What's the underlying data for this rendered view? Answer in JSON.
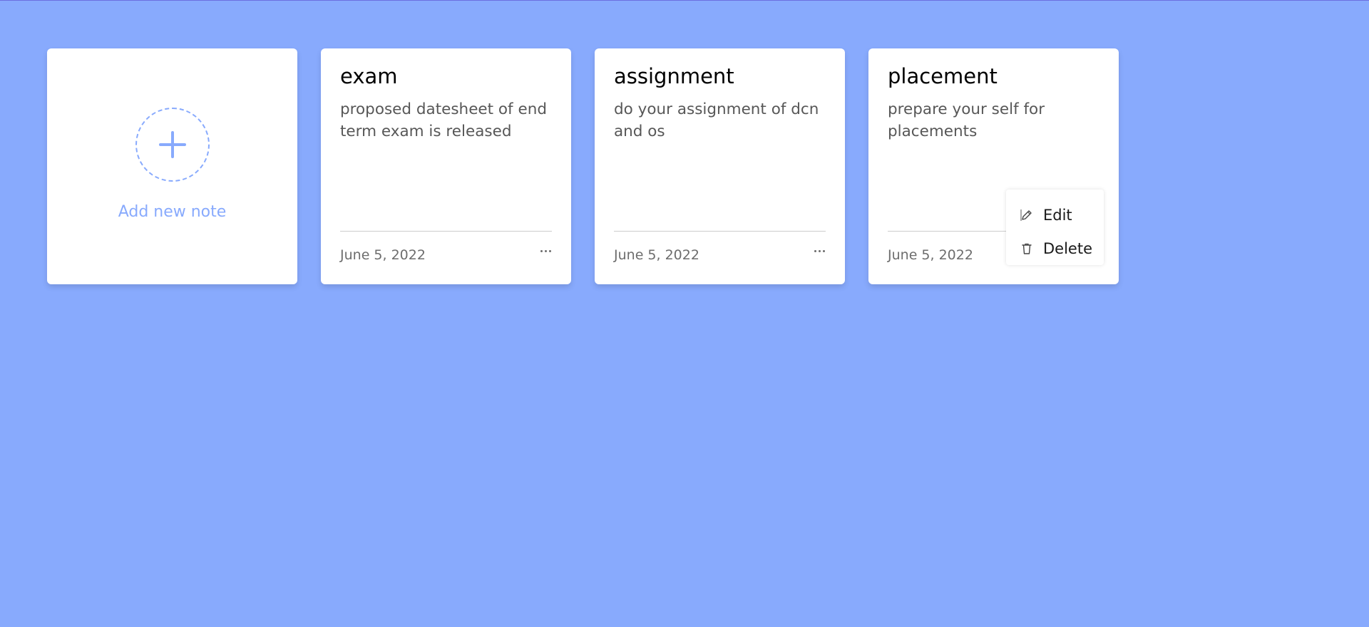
{
  "colors": {
    "background": "#88aafd",
    "accent": "#88aafd",
    "card": "#ffffff"
  },
  "add_note": {
    "label": "Add new note",
    "icon": "plus-icon"
  },
  "notes": [
    {
      "title": "exam",
      "description": "proposed datesheet of end term exam is released",
      "date": "June 5, 2022"
    },
    {
      "title": "assignment",
      "description": "do your assignment of dcn and os",
      "date": "June 5, 2022"
    },
    {
      "title": "placement",
      "description": "prepare your self for placements",
      "date": "June 5, 2022"
    }
  ],
  "menu": {
    "edit_label": "Edit",
    "delete_label": "Delete",
    "edit_icon": "pencil-icon",
    "delete_icon": "trash-icon"
  }
}
